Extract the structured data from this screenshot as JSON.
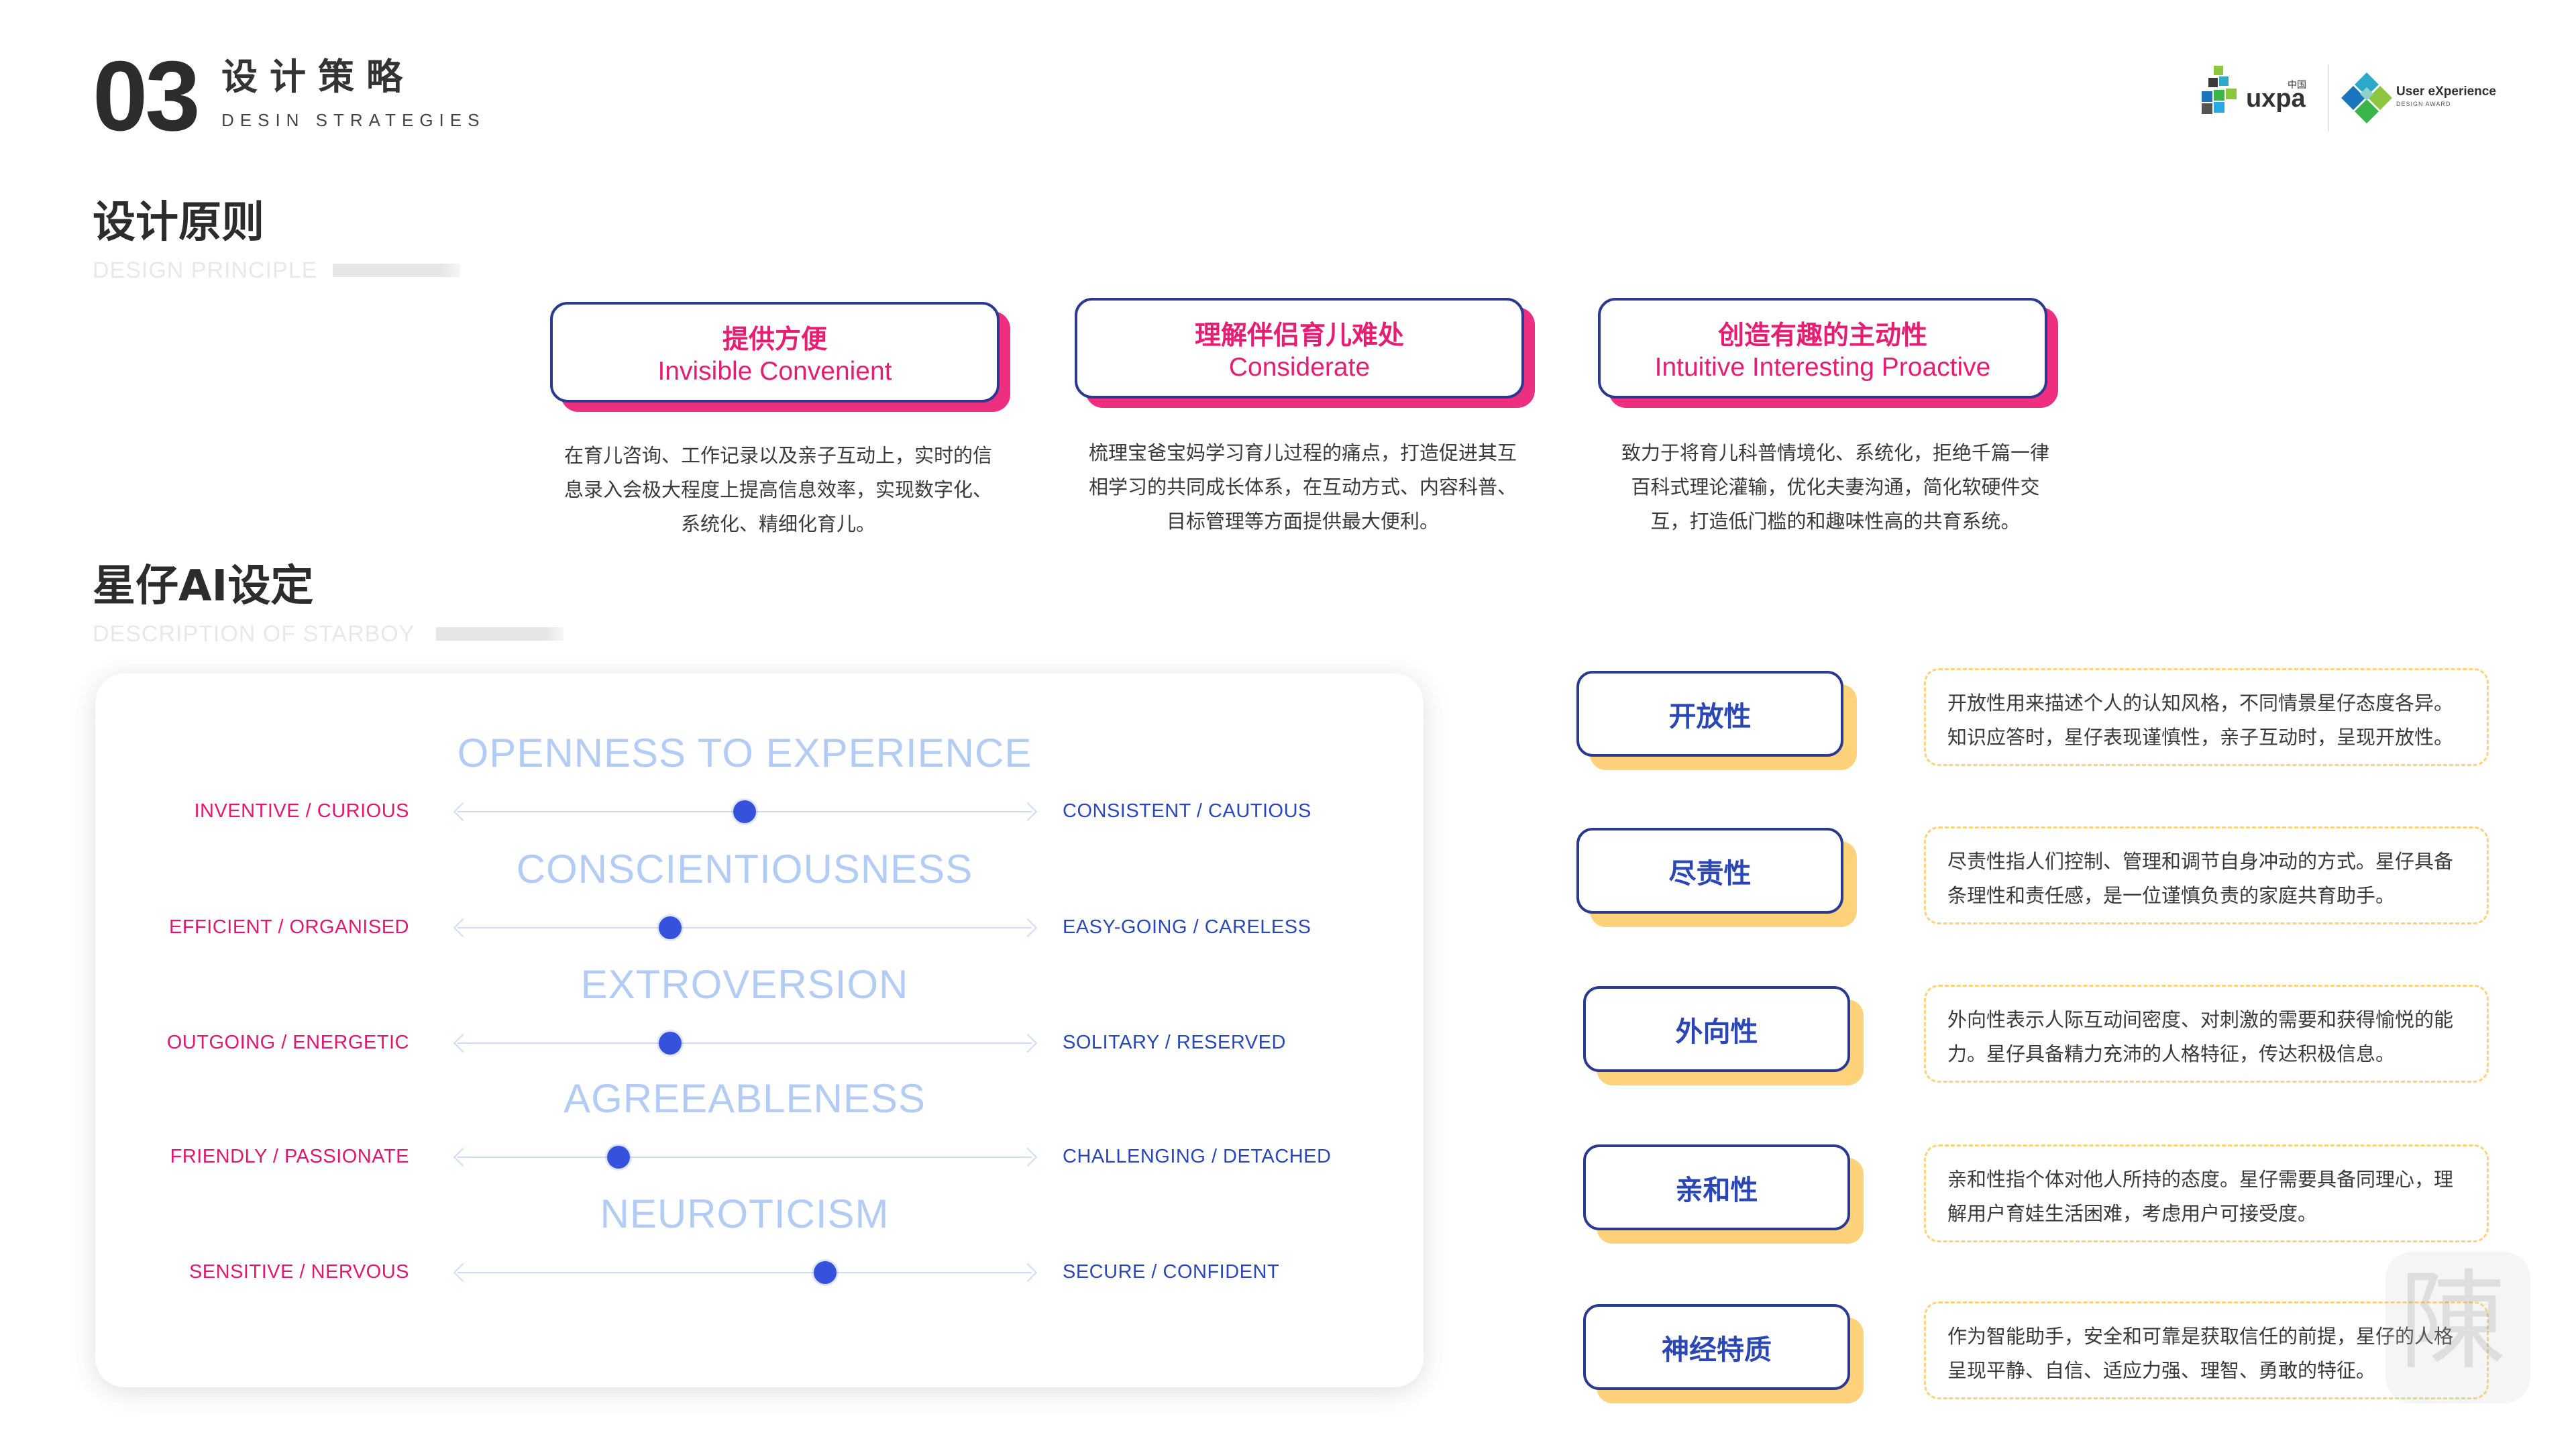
{
  "header": {
    "number": "03",
    "title": "设计策略",
    "subtitle": "DESIN STRATEGIES",
    "logos": {
      "uxpa_text": "uxpa",
      "uxpa_cn": "中国",
      "ux_award_line1": "User eXperience",
      "ux_award_line2": "DESIGN AWARD"
    }
  },
  "principles": {
    "heading": "设计原则",
    "heading_en": "DESIGN PRINCIPLE",
    "items": [
      {
        "cn": "提供方便",
        "en": "Invisible Convenient",
        "desc": "在育儿咨询、工作记录以及亲子互动上，实时的信息录入会极大程度上提高信息效率，实现数字化、系统化、精细化育儿。"
      },
      {
        "cn": "理解伴侣育儿难处",
        "en": "Considerate",
        "desc": "梳理宝爸宝妈学习育儿过程的痛点，打造促进其互相学习的共同成长体系，在互动方式、内容科普、目标管理等方面提供最大便利。"
      },
      {
        "cn": "创造有趣的主动性",
        "en": "Intuitive Interesting Proactive",
        "desc": "致力于将育儿科普情境化、系统化，拒绝千篇一律百科式理论灌输，优化夫妻沟通，简化软硬件交互，打造低门槛的和趣味性高的共育系统。"
      }
    ]
  },
  "starboy": {
    "heading": "星仔AI设定",
    "heading_en": "DESCRIPTION OF STARBOY",
    "traits": [
      {
        "title": "OPENNESS TO EXPERIENCE",
        "left": "INVENTIVE / CURIOUS",
        "right": "CONSISTENT / CAUTIOUS",
        "level": 0.5
      },
      {
        "title": "CONSCIENTIOUSNESS",
        "left": "EFFICIENT / ORGANISED",
        "right": "EASY-GOING / CARELESS",
        "level": 0.37
      },
      {
        "title": "EXTROVERSION",
        "left": "OUTGOING / ENERGETIC",
        "right": "SOLITARY / RESERVED",
        "level": 0.37
      },
      {
        "title": "AGREEABLENESS",
        "left": "FRIENDLY / PASSIONATE",
        "right": "CHALLENGING / DETACHED",
        "level": 0.28
      },
      {
        "title": "NEUROTICISM",
        "left": "SENSITIVE / NERVOUS",
        "right": "SECURE / CONFIDENT",
        "level": 0.64
      }
    ],
    "details": [
      {
        "name": "开放性",
        "desc": "开放性用来描述个人的认知风格，不同情景星仔态度各异。知识应答时，星仔表现谨慎性，亲子互动时，呈现开放性。"
      },
      {
        "name": "尽责性",
        "desc": "尽责性指人们控制、管理和调节自身冲动的方式。星仔具备条理性和责任感，是一位谨慎负责的家庭共育助手。"
      },
      {
        "name": "外向性",
        "desc": "外向性表示人际互动间密度、对刺激的需要和获得愉悦的能力。星仔具备精力充沛的人格特征，传达积极信息。"
      },
      {
        "name": "亲和性",
        "desc": "亲和性指个体对他人所持的态度。星仔需要具备同理心，理解用户育娃生活困难，考虑用户可接受度。"
      },
      {
        "name": "神经特质",
        "desc": "作为智能助手，安全和可靠是获取信任的前提，星仔的人格呈现平静、自信、适应力强、理智、勇敢的特征。"
      }
    ]
  },
  "colors": {
    "accent_pink": "#e51d73",
    "accent_blue": "#2a47b5",
    "accent_yellow": "#fdd27a"
  }
}
